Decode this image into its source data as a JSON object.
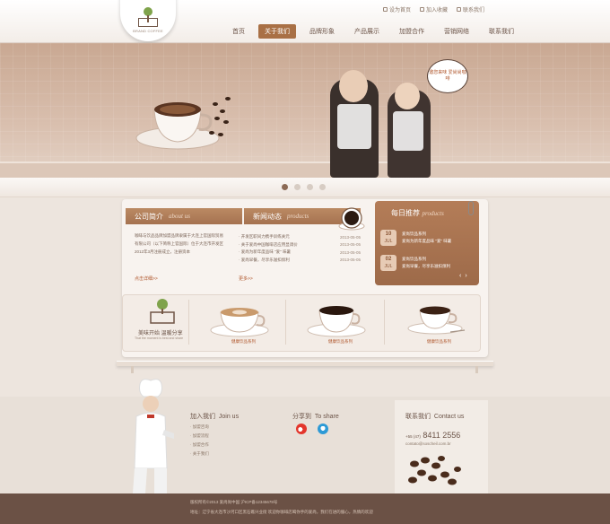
{
  "header": {
    "logo_caption": "BRAND COFFEE",
    "top_links": [
      "设为首页",
      "加入收藏",
      "联系我们"
    ],
    "nav": [
      "首页",
      "关于我们",
      "品牌形象",
      "产品展示",
      "加盟合作",
      "营销网络",
      "联系我们"
    ],
    "nav_active_index": 1
  },
  "banner": {
    "bubble_text": "邀您来味 爱尚尚咖啡",
    "slide_count": 4,
    "active_slide": 0
  },
  "about": {
    "title": "公司简介",
    "title_en": "about us",
    "text": "咖啡与饮品品牌加盟品牌隶属于大连上官国际贸易有限公司（以下简称上官国际）位于大连市开发区 2012年3月注册成立，注册资本",
    "more": "点击详细>>"
  },
  "news": {
    "title": "新闻动态",
    "title_en": "products",
    "items": [
      {
        "text": "· 开发区职间力携手训练关元",
        "date": "2013-05-05"
      },
      {
        "text": "· 关于爱尚中国咖啡店应用显调价",
        "date": "2013-05-05"
      },
      {
        "text": "· 爱尚为新年度品味 \"爱\" 味暑",
        "date": "2013-05-05"
      },
      {
        "text": "· 爱尚早餐，尽享乐滋扣烦利",
        "date": "2013-05-05"
      }
    ],
    "more": "更多>>"
  },
  "recommend": {
    "title": "每日推荐",
    "title_en": "products",
    "items": [
      {
        "day": "10",
        "month": "JUL",
        "title": "爱尚饮品系列",
        "desc": "爱尚为新年度品味 \"爱\" 味暑"
      },
      {
        "day": "02",
        "month": "JUL",
        "title": "爱尚饮品系列",
        "desc": "爱尚早餐，尽享乐滋扣烦利"
      }
    ],
    "prev": "‹",
    "next": "›"
  },
  "products": {
    "brand_slogan": "美味开始 温暖分享",
    "brand_sub": "That the moment is best and share",
    "labels": [
      "健康饮品系列",
      "健康饮品系列",
      "健康饮品系列"
    ]
  },
  "footer": {
    "join": {
      "title": "加入我们",
      "title_en": "Join us",
      "links": [
        "· 加盟咨询",
        "· 加盟流程",
        "· 加盟合作",
        "· 关于我们"
      ]
    },
    "share": {
      "title": "分享到",
      "title_en": "To share"
    },
    "contact": {
      "title": "联系我们",
      "title_en": "Contact us",
      "phone_prefix": "+55 (47)",
      "phone": "8411 2556",
      "email": "contato@soscheil.com.br"
    },
    "bottom_line1": "版权所有©2013 爱尚尚中国    沪ICP备12345678号",
    "bottom_line2": "地址：辽宁省大连市沙河口区黑石礁兴业街    欢迎你咖啡店喝你手的爱尚，我们在进的服心，热情的欢迎"
  },
  "colors": {
    "accent": "#a97045",
    "bottom_bar": "#6b5145",
    "text": "#6b5347"
  }
}
